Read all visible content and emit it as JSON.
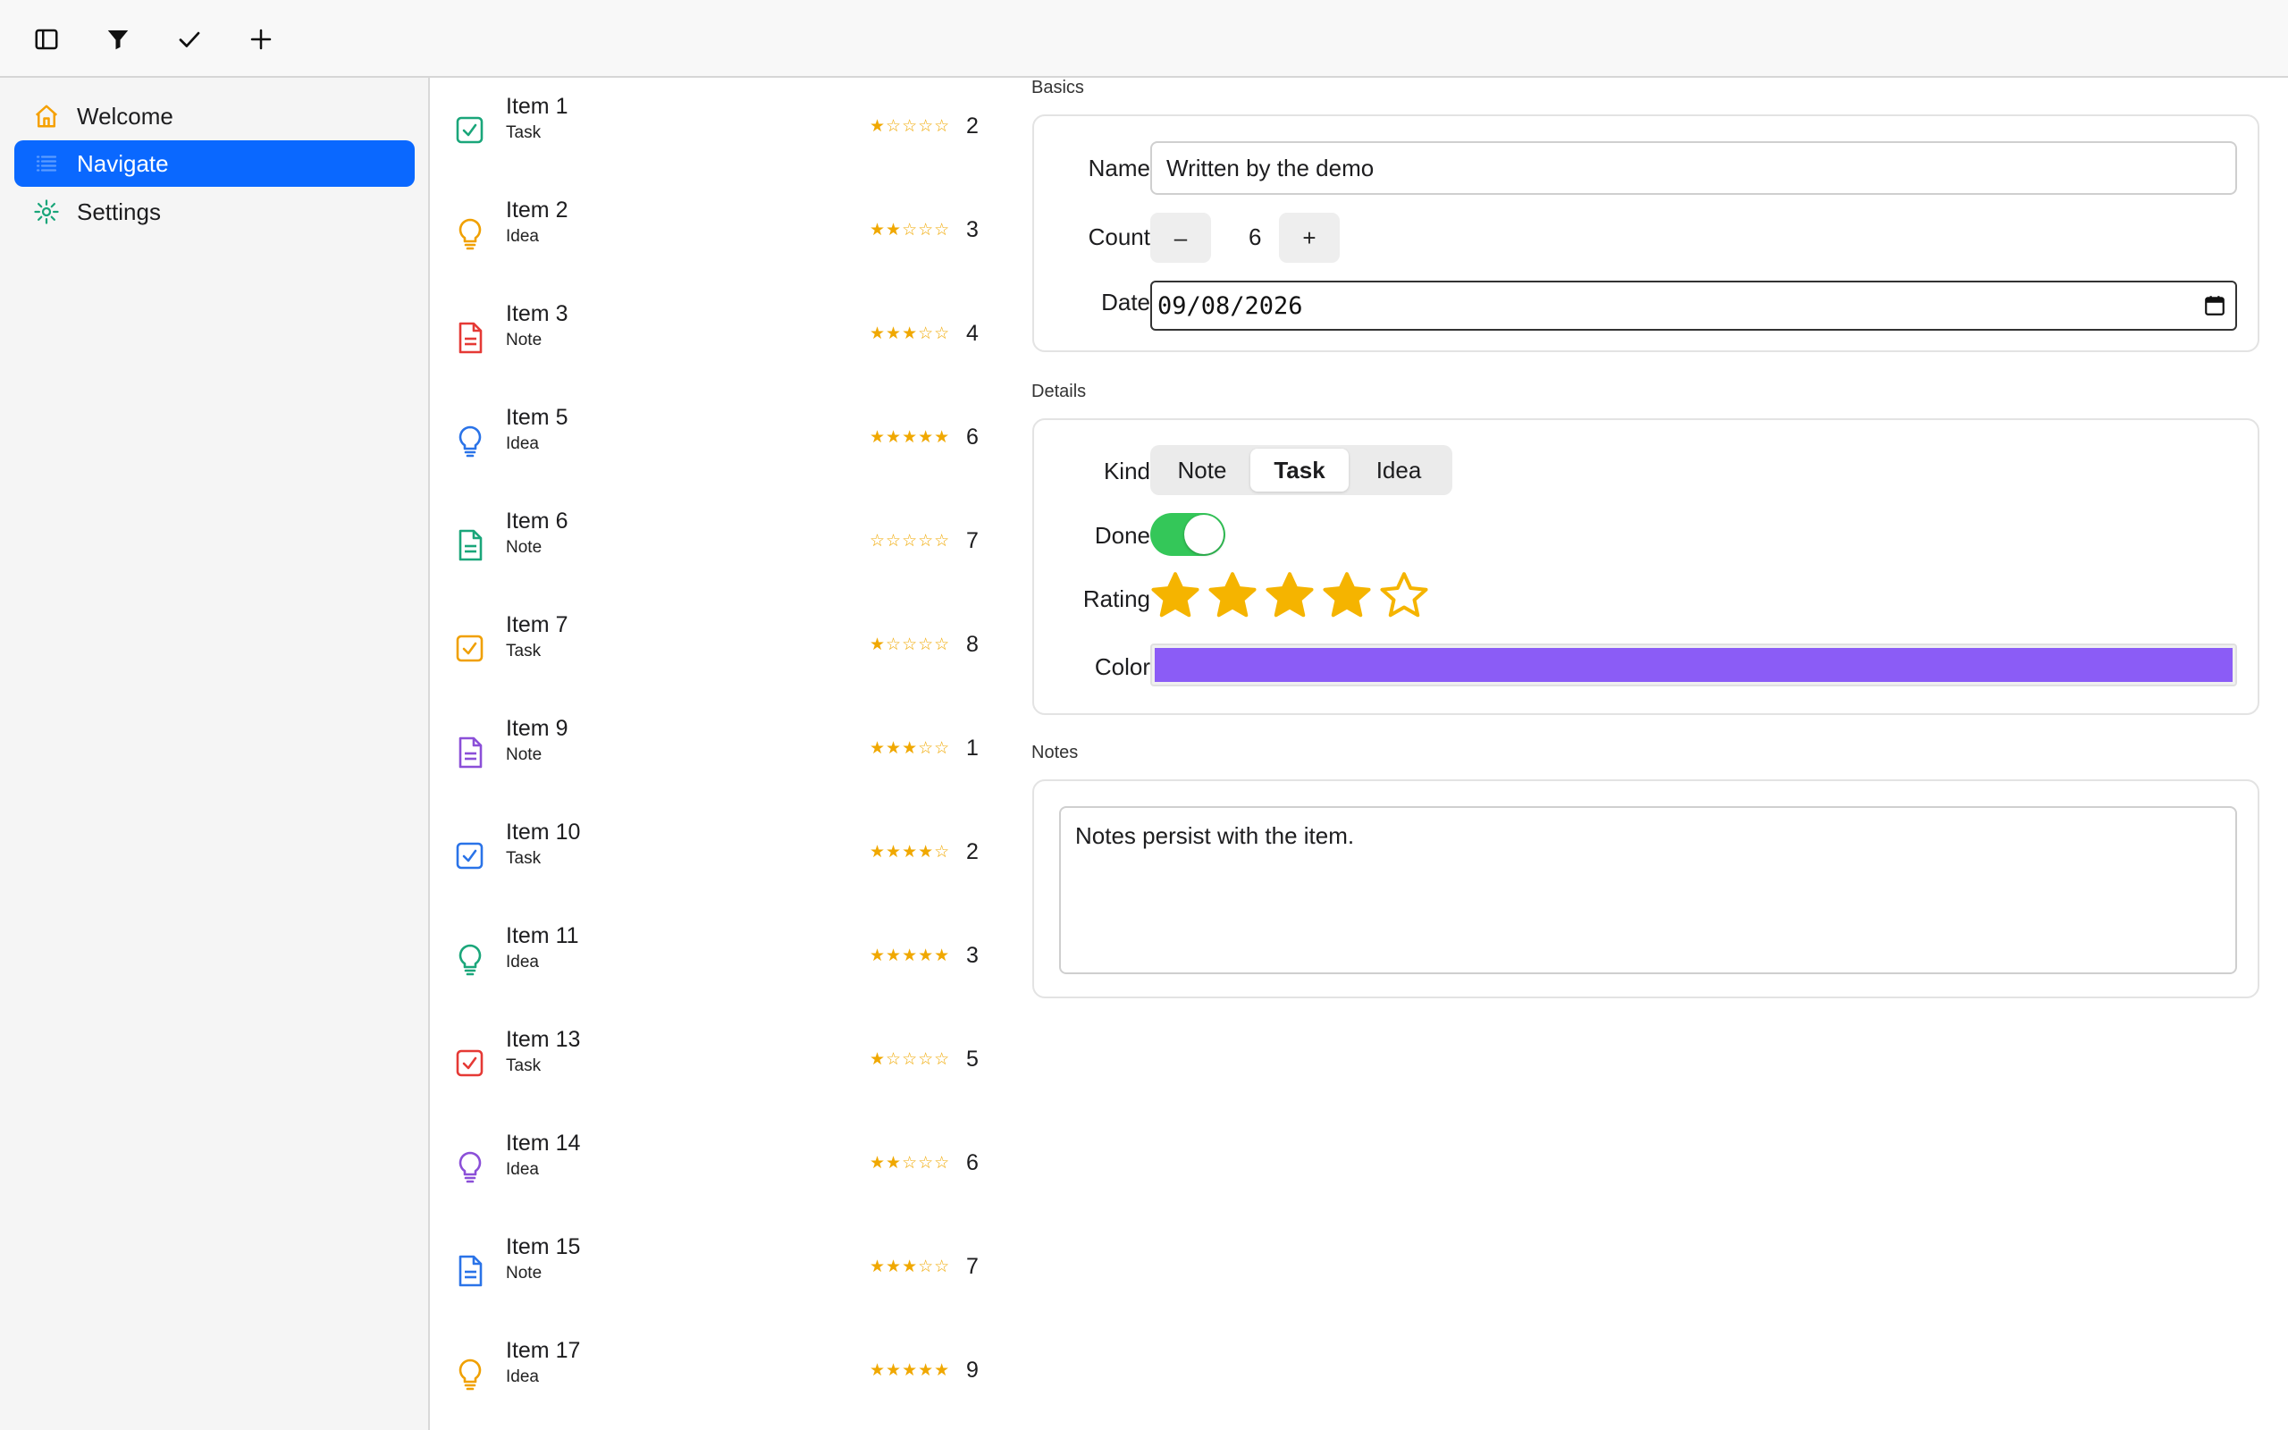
{
  "toolbar": {
    "buttons": [
      {
        "name": "sidebar-toggle",
        "icon": "sidebar-icon"
      },
      {
        "name": "filter",
        "icon": "filter-icon"
      },
      {
        "name": "checkmark",
        "icon": "checkmark-icon"
      },
      {
        "name": "add",
        "icon": "plus-icon"
      }
    ]
  },
  "sidebar": {
    "items": [
      {
        "label": "Welcome",
        "icon": "house-icon",
        "color": "#f5a000",
        "active": false
      },
      {
        "label": "Navigate",
        "icon": "list-icon",
        "color": "#ffffff",
        "active": true
      },
      {
        "label": "Settings",
        "icon": "gear-icon",
        "color": "#1aa67a",
        "active": false
      }
    ]
  },
  "list": {
    "rows": [
      {
        "title": "Item 1",
        "kind": "Task",
        "stars": "★☆☆☆☆",
        "count": "2",
        "icon": "checkbox-icon",
        "color": "#1aa67a"
      },
      {
        "title": "Item 2",
        "kind": "Idea",
        "stars": "★★☆☆☆",
        "count": "3",
        "icon": "lightbulb-icon",
        "color": "#f0a000"
      },
      {
        "title": "Item 3",
        "kind": "Note",
        "stars": "★★★☆☆",
        "count": "4",
        "icon": "document-icon",
        "color": "#e53935"
      },
      {
        "title": "Item 5",
        "kind": "Idea",
        "stars": "★★★★★",
        "count": "6",
        "icon": "lightbulb-icon",
        "color": "#2a73e8"
      },
      {
        "title": "Item 6",
        "kind": "Note",
        "stars": "☆☆☆☆☆",
        "count": "7",
        "icon": "document-icon",
        "color": "#1aa67a"
      },
      {
        "title": "Item 7",
        "kind": "Task",
        "stars": "★☆☆☆☆",
        "count": "8",
        "icon": "checkbox-icon",
        "color": "#f0a000"
      },
      {
        "title": "Item 9",
        "kind": "Note",
        "stars": "★★★☆☆",
        "count": "1",
        "icon": "document-icon",
        "color": "#8b4fd8"
      },
      {
        "title": "Item 10",
        "kind": "Task",
        "stars": "★★★★☆",
        "count": "2",
        "icon": "checkbox-icon",
        "color": "#2a73e8"
      },
      {
        "title": "Item 11",
        "kind": "Idea",
        "stars": "★★★★★",
        "count": "3",
        "icon": "lightbulb-icon",
        "color": "#1aa67a"
      },
      {
        "title": "Item 13",
        "kind": "Task",
        "stars": "★☆☆☆☆",
        "count": "5",
        "icon": "checkbox-icon",
        "color": "#e53935"
      },
      {
        "title": "Item 14",
        "kind": "Idea",
        "stars": "★★☆☆☆",
        "count": "6",
        "icon": "lightbulb-icon",
        "color": "#8b4fd8"
      },
      {
        "title": "Item 15",
        "kind": "Note",
        "stars": "★★★☆☆",
        "count": "7",
        "icon": "document-icon",
        "color": "#2a73e8"
      },
      {
        "title": "Item 17",
        "kind": "Idea",
        "stars": "★★★★★",
        "count": "9",
        "icon": "lightbulb-icon",
        "color": "#f0a000"
      }
    ]
  },
  "detail": {
    "basics": {
      "title": "Basics",
      "name_label": "Name",
      "name_value": "Written by the demo",
      "count_label": "Count",
      "count_value": "6",
      "minus_label": "–",
      "plus_label": "+",
      "date_label": "Date",
      "date_value": "09/08/2026"
    },
    "details": {
      "title": "Details",
      "kind_label": "Kind",
      "kind_options": [
        "Note",
        "Task",
        "Idea"
      ],
      "kind_selected": "Task",
      "done_label": "Done",
      "done_on": true,
      "rating_label": "Rating",
      "rating_value": 4,
      "rating_max": 5,
      "rating_color": "#f5b400",
      "color_label": "Color",
      "color_value": "#8b5cf6"
    },
    "notes": {
      "title": "Notes",
      "text": "Notes persist with the item."
    }
  }
}
